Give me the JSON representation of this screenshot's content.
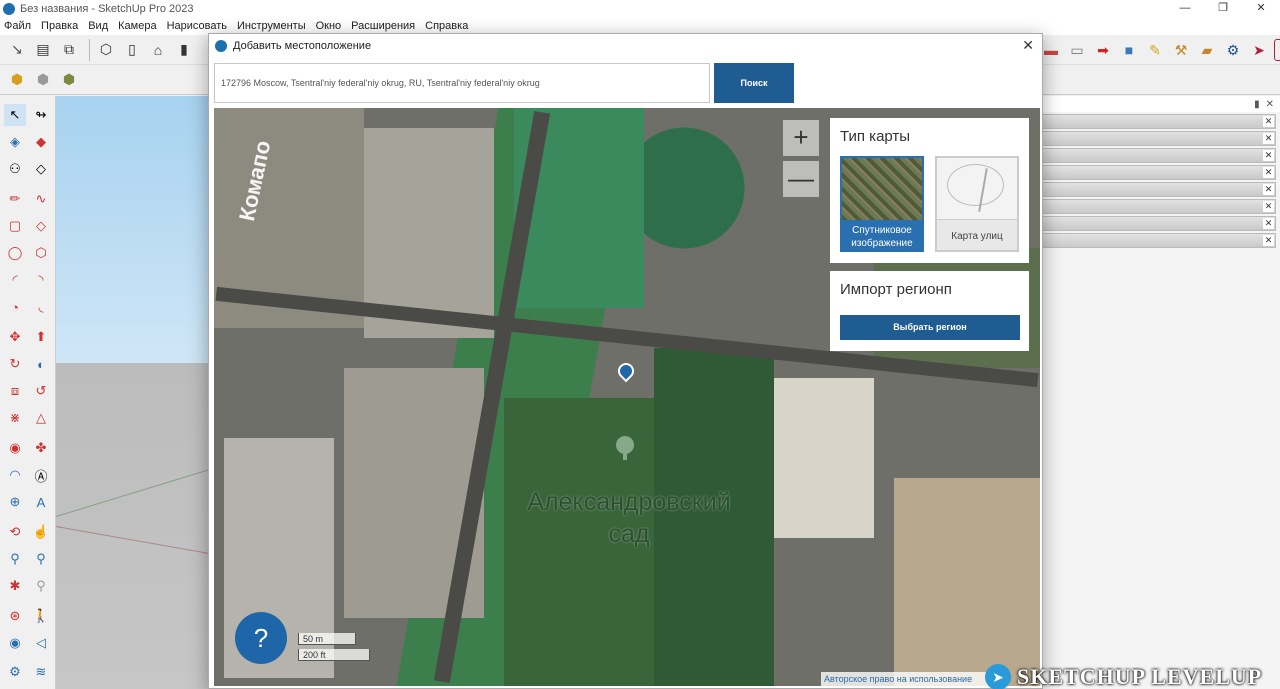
{
  "window": {
    "title": "Без названия - SketchUp Pro 2023",
    "controls": [
      "—",
      "❐",
      "✕"
    ]
  },
  "menu": [
    "Файл",
    "Правка",
    "Вид",
    "Камера",
    "Нарисовать",
    "Инструменты",
    "Окно",
    "Расширения",
    "Справка"
  ],
  "dialog": {
    "title": "Добавить местоположение",
    "close": "✕",
    "search_value": "172796 Moscow, Tsentral'niy federal'niy okrug, RU, Tsentral'niy federal'niy okrug",
    "search_button": "Поиск"
  },
  "map": {
    "zoom_in": "+",
    "zoom_out": "—",
    "label_park_line1": "Александровский",
    "label_park_line2": "сад",
    "label_street": "Комапо",
    "help": "?",
    "scale_m": "50 m",
    "scale_ft": "200 ft",
    "copyright": "Авторское право на использование"
  },
  "map_type": {
    "title": "Тип карты",
    "satellite_line1": "Спутниковое",
    "satellite_line2": "изображение",
    "street": "Карта улиц",
    "selected": "satellite"
  },
  "import_region": {
    "title": "Импорт регионп",
    "button": "Выбрать регион"
  },
  "watermark": "SKETCHUP LEVELUP",
  "colors": {
    "accent": "#1e5c92",
    "sky": "#a7d2f0",
    "pin": "#1e66a8"
  }
}
